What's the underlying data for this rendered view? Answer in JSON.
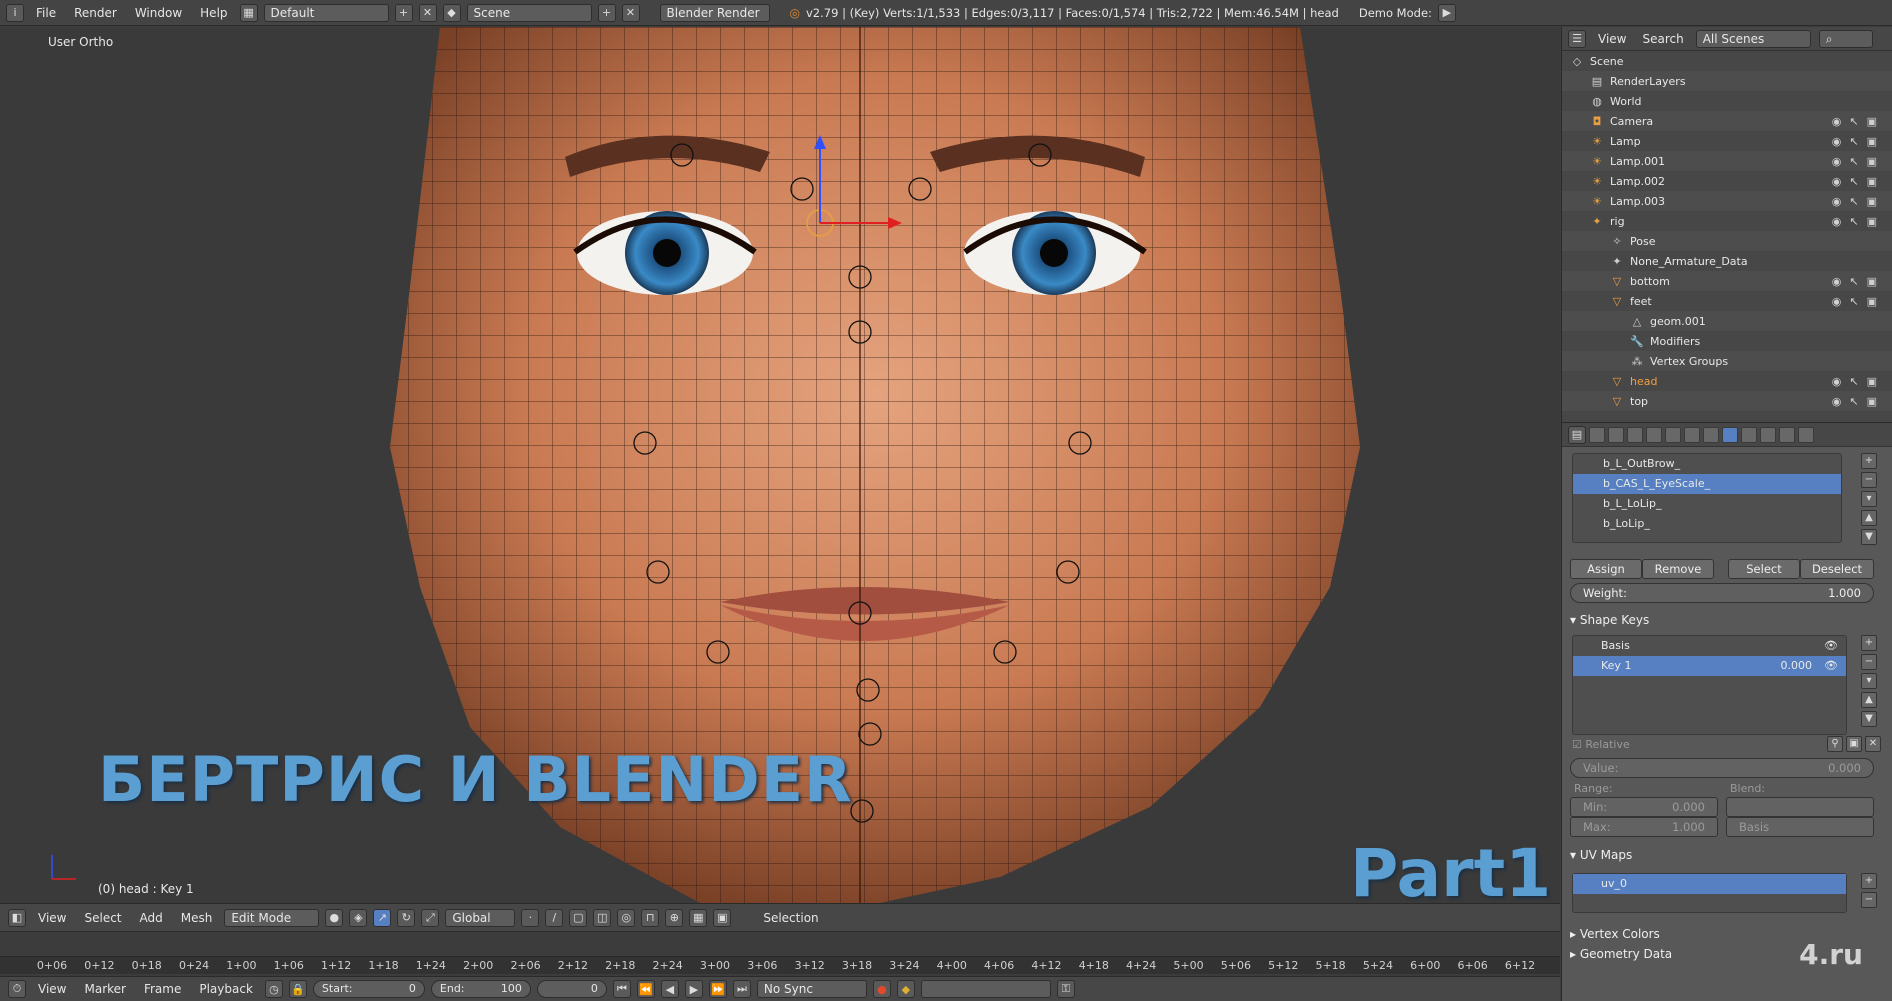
{
  "topbar": {
    "menus": [
      "File",
      "Render",
      "Window",
      "Help"
    ],
    "layout": "Default",
    "scene": "Scene",
    "engine": "Blender Render",
    "stats": "v2.79 | (Key) Verts:1/1,533 | Edges:0/3,117 | Faces:0/1,574 | Tris:2,722 | Mem:46.54M | head",
    "demo_mode": "Demo Mode:"
  },
  "viewport": {
    "title": "User Ortho",
    "object_label": "(0) head : Key 1",
    "overlay_title": "БЕРТРИС И BLENDER",
    "overlay_part": "Part1",
    "accent_color": "#5b9ed1"
  },
  "vp_header": {
    "menus": [
      "View",
      "Select",
      "Add",
      "Mesh"
    ],
    "mode": "Edit Mode",
    "orientation": "Global",
    "selection_label": "Selection"
  },
  "timeline": {
    "ticks": [
      "0+06",
      "0+12",
      "0+18",
      "0+24",
      "1+00",
      "1+06",
      "1+12",
      "1+18",
      "1+24",
      "2+00",
      "2+06",
      "2+12",
      "2+18",
      "2+24",
      "3+00",
      "3+06",
      "3+12",
      "3+18",
      "3+24",
      "4+00",
      "4+06",
      "4+12",
      "4+18",
      "4+24",
      "5+00",
      "5+06",
      "5+12",
      "5+18",
      "5+24",
      "6+00",
      "6+06",
      "6+12"
    ],
    "menus": [
      "View",
      "Marker",
      "Frame",
      "Playback"
    ],
    "start_label": "Start:",
    "start_value": "0",
    "end_label": "End:",
    "end_value": "100",
    "current_frame": "0",
    "sync": "No Sync"
  },
  "outliner": {
    "menus": [
      "View",
      "Search"
    ],
    "filter": "All Scenes",
    "rows": [
      {
        "label": "Scene",
        "icon": "scene-icon",
        "indent": 0
      },
      {
        "label": "RenderLayers",
        "icon": "renderlayers-icon",
        "indent": 1
      },
      {
        "label": "World",
        "icon": "world-icon",
        "indent": 1
      },
      {
        "label": "Camera",
        "icon": "camera-icon",
        "indent": 1
      },
      {
        "label": "Lamp",
        "icon": "lamp-icon",
        "indent": 1
      },
      {
        "label": "Lamp.001",
        "icon": "lamp-icon",
        "indent": 1
      },
      {
        "label": "Lamp.002",
        "icon": "lamp-icon",
        "indent": 1
      },
      {
        "label": "Lamp.003",
        "icon": "lamp-icon",
        "indent": 1
      },
      {
        "label": "rig",
        "icon": "armature-icon",
        "indent": 1
      },
      {
        "label": "Pose",
        "icon": "pose-icon",
        "indent": 2
      },
      {
        "label": "None_Armature_Data",
        "icon": "armature-data-icon",
        "indent": 2
      },
      {
        "label": "bottom",
        "icon": "mesh-icon",
        "indent": 2
      },
      {
        "label": "feet",
        "icon": "mesh-icon",
        "indent": 2
      },
      {
        "label": "geom.001",
        "icon": "mesh-data-icon",
        "indent": 3
      },
      {
        "label": "Modifiers",
        "icon": "wrench-icon",
        "indent": 3
      },
      {
        "label": "Vertex Groups",
        "icon": "vertex-groups-icon",
        "indent": 3
      },
      {
        "label": "head",
        "icon": "mesh-icon",
        "indent": 2
      },
      {
        "label": "top",
        "icon": "mesh-icon",
        "indent": 2
      }
    ]
  },
  "properties": {
    "vertex_groups": [
      "b_L_OutBrow_",
      "b_CAS_L_EyeScale_",
      "b_L_LoLip_",
      "b_LoLip_"
    ],
    "selected_group": "b_CAS_L_EyeScale_",
    "buttons": {
      "assign": "Assign",
      "remove": "Remove",
      "select": "Select",
      "deselect": "Deselect"
    },
    "weight_label": "Weight:",
    "weight_value": "1.000",
    "shape_keys_title": "Shape Keys",
    "shape_keys": [
      {
        "name": "Basis",
        "value": ""
      },
      {
        "name": "Key 1",
        "value": "0.000"
      }
    ],
    "relative_label": "Relative",
    "value_label": "Value:",
    "value_value": "0.000",
    "range_label": "Range:",
    "blend_label": "Blend:",
    "min_label": "Min:",
    "min_value": "0.000",
    "max_label": "Max:",
    "max_value": "1.000",
    "blend_value": "Basis",
    "uv_maps_title": "UV Maps",
    "uv_map": "uv_0",
    "vertex_colors_title": "Vertex Colors",
    "geometry_data_title": "Geometry Data"
  },
  "watermark": "4.ru"
}
